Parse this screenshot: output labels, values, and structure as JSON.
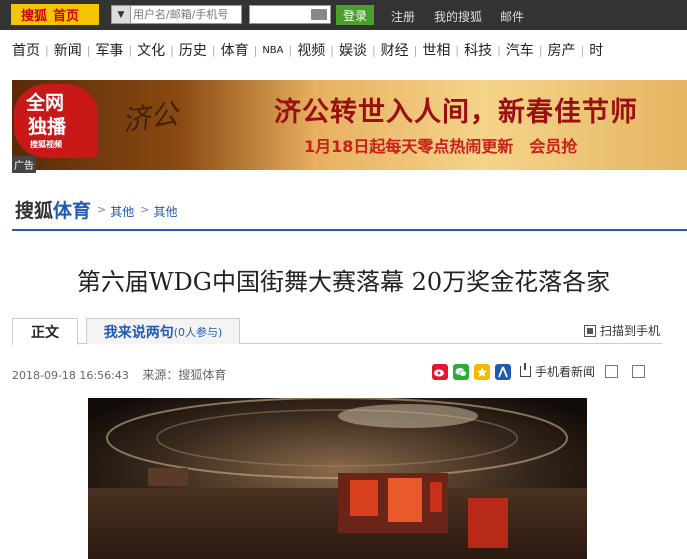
{
  "topbar": {
    "logo": "搜狐",
    "home": "首页",
    "account_placeholder": "用户名/邮箱/手机号",
    "login": "登录",
    "links": [
      "注册",
      "我的搜狐",
      "邮件"
    ]
  },
  "nav": {
    "items": [
      "首页",
      "新闻",
      "军事",
      "文化",
      "历史",
      "体育",
      "NBA",
      "视频",
      "娱谈",
      "财经",
      "世相",
      "科技",
      "汽车",
      "房产",
      "时"
    ]
  },
  "banner": {
    "badge_line1": "全网",
    "badge_line2": "独播",
    "badge_line3": "搜狐视频",
    "calligraphy": "济公",
    "headline": "济公转世入人间，新春佳节师",
    "subline": "1月18日起每天零点热闹更新　会员抢",
    "ad_label": "广告"
  },
  "breadcrumb": {
    "site": "搜狐",
    "section": "体育",
    "crumbs": [
      "其他",
      "其他"
    ]
  },
  "article": {
    "title": "第六届WDG中国街舞大赛落幕 20万奖金花落各家",
    "tab_main": "正文",
    "tab_comment": "我来说两句",
    "tab_comment_count": "(0人参与)",
    "scan_label": "扫描到手机",
    "date": "2018-09-18 16:56:43",
    "source": "来源：搜狐体育",
    "mobile_news": "手机看新闻"
  },
  "colors": {
    "accent_blue": "#1f5bb5",
    "logo_yellow": "#f5c400",
    "login_green": "#4a9f2a",
    "topbar_bg": "#333333"
  },
  "icons": [
    "weibo-icon",
    "wechat-icon",
    "qzone-icon",
    "renren-icon",
    "download-icon",
    "image-icon",
    "print-icon",
    "qr-icon"
  ]
}
